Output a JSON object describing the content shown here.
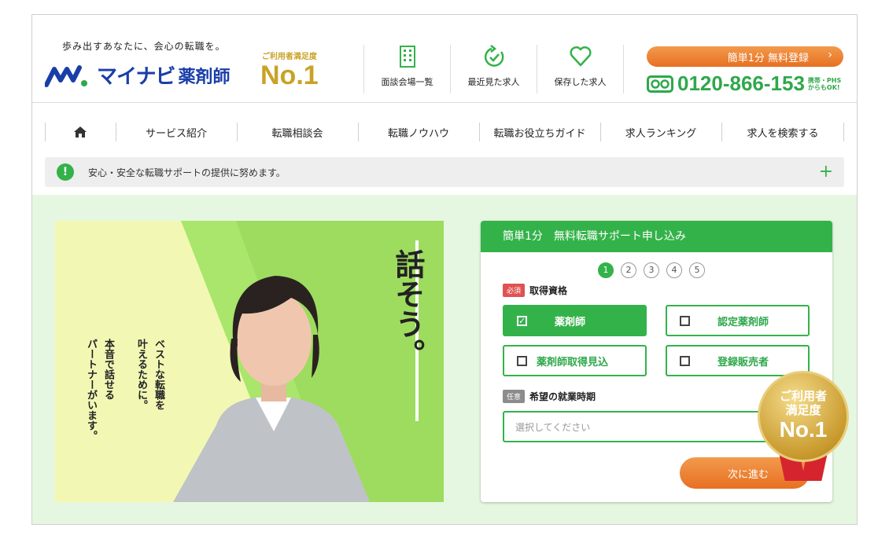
{
  "header": {
    "tagline": "歩み出すあなたに、会心の転職を。",
    "logo_text": "マイナビ",
    "logo_sub": "薬剤師",
    "satisfaction_label": "ご利用者満足度",
    "satisfaction_value": "No.1",
    "nav": [
      {
        "label": "面談会場一覧",
        "icon": "building-icon"
      },
      {
        "label": "最近見た求人",
        "icon": "history-clock-icon"
      },
      {
        "label": "保存した求人",
        "icon": "heart-icon"
      }
    ],
    "register_button": "簡単1分 無料登録",
    "phone_badge": "ᴏᴏ",
    "phone_number": "0120-866-153",
    "phone_note_1": "携帯・PHS",
    "phone_note_2": "からもOK!"
  },
  "main_nav": {
    "home_icon": "home-icon",
    "items": [
      "サービス紹介",
      "転職相談会",
      "転職ノウハウ",
      "転職お役立ちガイド",
      "求人ランキング",
      "求人を検索する"
    ]
  },
  "notice": {
    "icon": "exclamation-icon",
    "text": "安心・安全な転職サポートの提供に努めます。",
    "expand": "+"
  },
  "hero": {
    "catch": "話そう。",
    "copy_1": "ベストな転職を",
    "copy_2": "叶えるために。",
    "copy_3": "本音で話せる",
    "copy_4": "パートナーがいます。"
  },
  "form": {
    "title": "簡単1分　無料転職サポート申し込み",
    "steps": [
      "1",
      "2",
      "3",
      "4",
      "5"
    ],
    "active_step": 1,
    "qualification_tag": "必須",
    "qualification_label": "取得資格",
    "options": [
      {
        "label": "薬剤師",
        "checked": true
      },
      {
        "label": "認定薬剤師",
        "checked": false
      },
      {
        "label": "薬剤師取得見込",
        "checked": false
      },
      {
        "label": "登録販売者",
        "checked": false
      }
    ],
    "timing_tag": "任意",
    "timing_label": "希望の就業時期",
    "timing_placeholder": "選択してください",
    "next_button": "次に進む"
  },
  "medal": {
    "line1": "ご利用者",
    "line2": "満足度",
    "line3": "No.1"
  },
  "colors": {
    "brand_green": "#34b24a",
    "brand_blue": "#1a3ea8",
    "accent_orange": "#e77022",
    "gold": "#c9a227"
  }
}
